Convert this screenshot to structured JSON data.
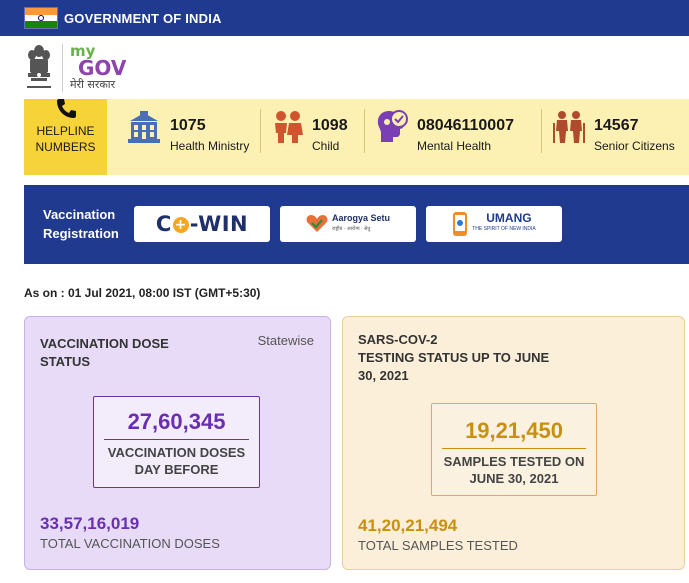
{
  "header": {
    "gov_title": "GOVERNMENT OF INDIA",
    "flag_colors": [
      "#ff9933",
      "#ffffff",
      "#138808"
    ],
    "brand_color": "#1f3a8f"
  },
  "logo": {
    "emblem_icon": "state-emblem-icon",
    "my": "my",
    "gov": "GOV",
    "tagline": "मेरी सरकार"
  },
  "helpline": {
    "label_line1": "HELPLINE",
    "label_line2": "NUMBERS",
    "items": [
      {
        "number": "1075",
        "label": "Health Ministry",
        "icon": "hospital-icon"
      },
      {
        "number": "1098",
        "label": "Child",
        "icon": "children-icon"
      },
      {
        "number": "08046110007",
        "label": "Mental Health",
        "icon": "mental-health-icon"
      },
      {
        "number": "14567",
        "label": "Senior Citizens",
        "icon": "senior-citizens-icon"
      }
    ]
  },
  "vaccination_registration": {
    "label_line1": "Vaccination",
    "label_line2": "Registration",
    "cowin_c": "C",
    "cowin_plus": "+",
    "cowin_rest": "-WIN",
    "aarogya_name": "Aarogya Setu",
    "aarogya_sub": "राष्ट्रीय · आरोग्य · सेतु",
    "umang_name": "UMANG",
    "umang_sub": "THE SPIRIT OF NEW INDIA"
  },
  "as_on": "As on : 01 Jul 2021, 08:00 IST (GMT+5:30)",
  "vaccination_card": {
    "title_line1": "VACCINATION DOSE",
    "title_line2": "STATUS",
    "statewise": "Statewise",
    "day_value": "27,60,345",
    "day_label_line1": "VACCINATION DOSES",
    "day_label_line2": "DAY BEFORE",
    "total_value": "33,57,16,019",
    "total_label": "TOTAL VACCINATION DOSES",
    "accent_color": "#6a2fb0"
  },
  "testing_card": {
    "title_line1": "SARS-COV-2",
    "title_line2": "TESTING STATUS UP TO JUNE",
    "title_line3": "30, 2021",
    "day_value": "19,21,450",
    "day_label_line1": "SAMPLES TESTED ON",
    "day_label_line2": "JUNE 30, 2021",
    "total_value": "41,20,21,494",
    "total_label": "TOTAL SAMPLES TESTED",
    "accent_color": "#c8900e"
  }
}
